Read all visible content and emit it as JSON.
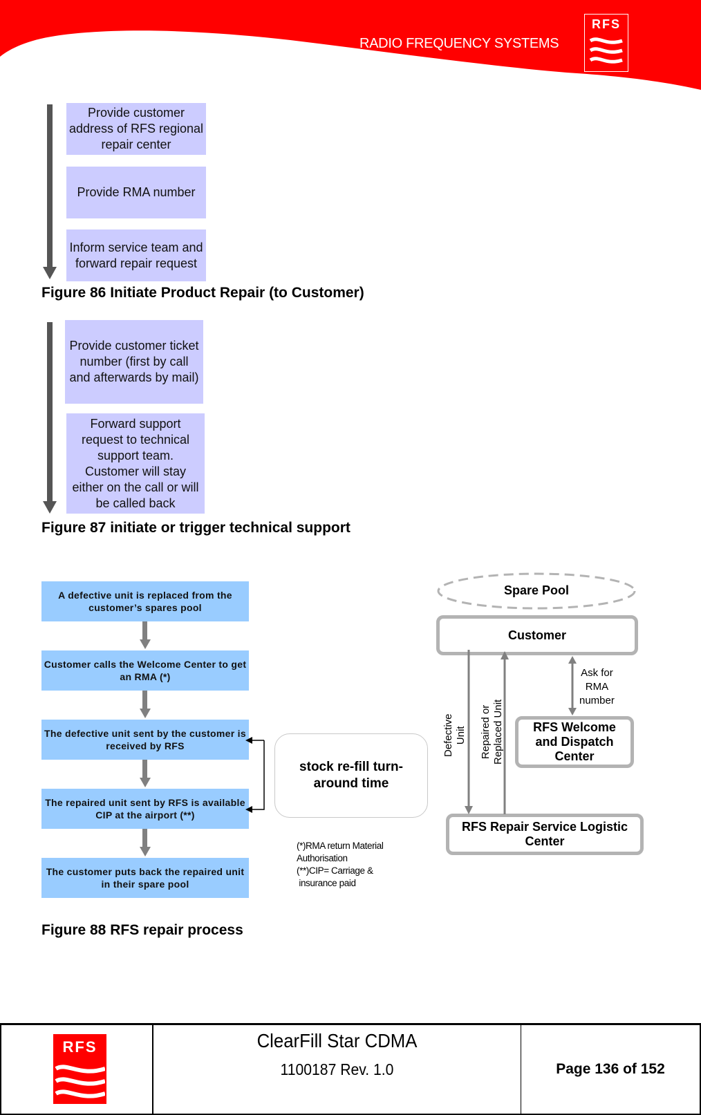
{
  "header": {
    "brand_text": "RADIO FREQUENCY SYSTEMS",
    "logo_text": "RFS",
    "brand_color": "#ff0000"
  },
  "figure86": {
    "steps": [
      "Provide customer address of RFS regional repair center",
      "Provide RMA number",
      "Inform service team and forward repair request"
    ],
    "caption": "Figure 86 Initiate Product Repair (to Customer)"
  },
  "figure87": {
    "steps": [
      "Provide customer ticket number (first by call and afterwards by mail)",
      "Forward support request to technical support team. Customer will stay either on the call or will be called back"
    ],
    "caption": "Figure 87 initiate or trigger technical support"
  },
  "figure88": {
    "process_steps": [
      "A defective unit is replaced from the customer’s spares pool",
      "Customer calls the Welcome Center to get an RMA (*)",
      "The defective unit sent by the customer is received by RFS",
      "The repaired unit sent by RFS is available CIP at the airport (**)",
      "The customer puts back the repaired unit in their spare pool"
    ],
    "turnaround_label": "stock re-fill turn-around time",
    "notes": [
      "(*)RMA return Material",
      "Authorisation",
      "(**)CIP=  Carriage &",
      " insurance paid"
    ],
    "spare_pool": "Spare Pool",
    "customer": "Customer",
    "ask_for_rma": [
      "Ask for",
      "RMA",
      "number"
    ],
    "welcome_center": "RFS Welcome and Dispatch Center",
    "repair_center": "RFS Repair Service Logistic Center",
    "defective_unit": [
      "Defective",
      "Unit"
    ],
    "repaired_unit": [
      "Repaired or",
      "Replaced Unit"
    ],
    "caption": "Figure 88 RFS repair process"
  },
  "footer": {
    "logo_text": "RFS",
    "product": "ClearFill Star CDMA",
    "doc_number": "1100187 Rev. 1.0",
    "page": "Page 136 of 152"
  }
}
